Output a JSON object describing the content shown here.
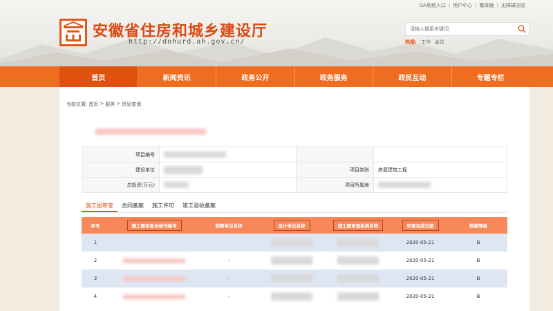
{
  "top_links": [
    "OA系统入口",
    "用户中心",
    "繁体版",
    "无障碍浏览"
  ],
  "site": {
    "title": "安徽省住房和城乡建设厅",
    "url": "http://dohurd.ah.gov.cn/"
  },
  "search": {
    "placeholder": "请输入搜索关键词",
    "hot_label": "热搜:",
    "hot_terms": [
      "工作",
      "会议"
    ]
  },
  "nav": {
    "items": [
      "首页",
      "新闻资讯",
      "政务公开",
      "政务服务",
      "政民互动",
      "专题专栏"
    ],
    "active_index": 0
  },
  "breadcrumb": [
    "当前位置:",
    "首页",
    ">",
    "服务",
    ">",
    "信息查询"
  ],
  "info": {
    "project_no_label": "项目编号",
    "builder_label": "建设单位",
    "project_type_label": "项目类别",
    "project_type_value": "房屋建筑工程",
    "investment_label": "总投资(万元)",
    "project_location_label": "项目所属地"
  },
  "tabs": [
    "施工图审查",
    "合同备案",
    "施工许可",
    "竣工验收备案"
  ],
  "active_tab": 0,
  "table": {
    "columns": [
      "序号",
      "施工图审查合格书编号",
      "勘察单位名称",
      "设计单位名称",
      "施工图审查机构名称",
      "审查完成日期",
      "数据等级"
    ],
    "rows": [
      {
        "index": "1",
        "survey": "",
        "date": "2020-05-21",
        "grade": "B"
      },
      {
        "index": "2",
        "survey": "-",
        "date": "2020-05-21",
        "grade": "B"
      },
      {
        "index": "3",
        "survey": "-",
        "date": "2020-05-21",
        "grade": "B"
      },
      {
        "index": "4",
        "survey": "-",
        "date": "2020-05-21",
        "grade": "B"
      }
    ]
  },
  "colors": {
    "brand_orange": "#f06c1e",
    "title_red": "#d94a14",
    "table_header": "#f6885a",
    "row_stripe": "#dfe6f3"
  }
}
